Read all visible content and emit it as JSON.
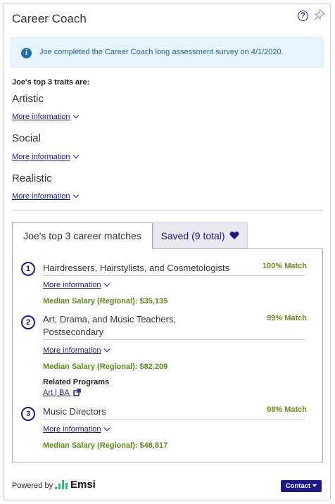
{
  "header": {
    "title": "Career Coach",
    "help_glyph": "?"
  },
  "alert": {
    "text": "Joe completed the Career Coach long assessment survey on 4/1/2020.",
    "icon": "info-icon",
    "info_glyph": "i"
  },
  "traits": {
    "heading": "Joe's top 3 traits are:",
    "items": [
      {
        "name": "Artistic",
        "link": "More information"
      },
      {
        "name": "Social",
        "link": "More information"
      },
      {
        "name": "Realistic",
        "link": "More information"
      }
    ]
  },
  "tabs": {
    "active_label": "Joe's top 3 career matches",
    "saved_label": "Saved (9 total)"
  },
  "careers": [
    {
      "rank": "1",
      "title": "Hairdressers, Hairstylists, and Cosmetologists",
      "match": "100% Match",
      "link": "More information",
      "salary": "Median Salary (Regional): $35,135"
    },
    {
      "rank": "2",
      "title_line1": "Art, Drama, and Music Teachers,",
      "title_line2": "Postsecondary",
      "match": "99% Match",
      "link": "More information",
      "salary": "Median Salary (Regional): $82,209",
      "related_label": "Related Programs",
      "related_link": "Art | BA"
    },
    {
      "rank": "3",
      "title": "Music Directors",
      "match": "98% Match",
      "link": "More information",
      "salary": "Median Salary (Regional): $48,817"
    }
  ],
  "footer": {
    "powered_by": "Powered by",
    "brand": "Emsi",
    "contact_label": "Contact"
  },
  "colors": {
    "accent": "#1a1a8c",
    "salary_green": "#5a8a1a",
    "alert_bg": "#e6f4fb",
    "brand_green": "#2dbf8a"
  }
}
